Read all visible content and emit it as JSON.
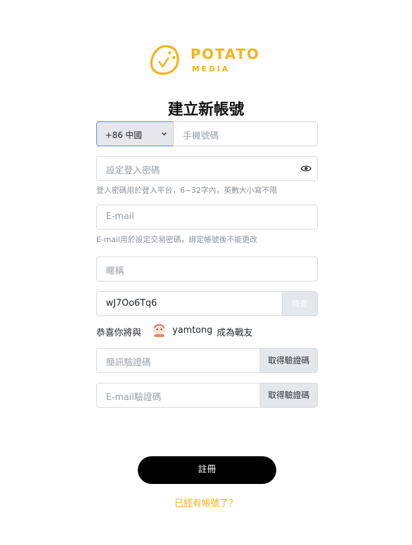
{
  "brand": {
    "line1": "POTATO",
    "line2": "MEDIA",
    "accent": "#f5b21a",
    "icon": "potato-mascot-icon"
  },
  "page": {
    "title": "建立新帳號"
  },
  "phone": {
    "country_value": "+86 中國",
    "placeholder": "手機號碼"
  },
  "password": {
    "placeholder": "設定登入密碼",
    "hint": "登入密碼用於登入平台，6~32字內，英數大小寫不限",
    "toggle_icon": "eye-icon"
  },
  "email": {
    "placeholder": "E-mail",
    "hint": "E-mail用於設定交易密碼，綁定帳號後不能更改"
  },
  "nickname": {
    "placeholder": "暱稱"
  },
  "invite_code": {
    "value": "wJ7Oo6Tq6",
    "check_label": "檢查"
  },
  "invite_msg": {
    "prefix": "恭喜你將與",
    "username": "yamtong",
    "suffix": "成為戰友"
  },
  "sms_code": {
    "placeholder": "簡訊驗證碼",
    "button": "取得驗證碼"
  },
  "email_code": {
    "placeholder": "E-mail驗證碼",
    "button": "取得驗證碼"
  },
  "actions": {
    "register": "註冊",
    "have_account": "已經有帳號了？"
  }
}
